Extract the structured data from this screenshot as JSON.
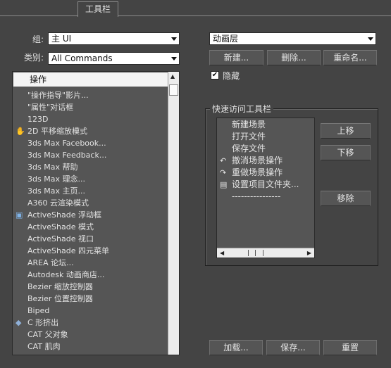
{
  "tab": {
    "label": "工具栏"
  },
  "group_field": {
    "label": "组:",
    "value": "主 UI"
  },
  "category_field": {
    "label": "类别:",
    "value": "All Commands"
  },
  "actions": {
    "header": "操作",
    "items": [
      {
        "icon": "",
        "label": "\"操作指导\"影片..."
      },
      {
        "icon": "",
        "label": "\"属性\"对话框"
      },
      {
        "icon": "",
        "label": "123D"
      },
      {
        "icon": "hand-pan-icon",
        "label": "2D 平移缩放模式"
      },
      {
        "icon": "",
        "label": "3ds Max Facebook..."
      },
      {
        "icon": "",
        "label": "3ds Max Feedback..."
      },
      {
        "icon": "",
        "label": "3ds Max 帮助"
      },
      {
        "icon": "",
        "label": "3ds Max 理念..."
      },
      {
        "icon": "",
        "label": "3ds Max 主页..."
      },
      {
        "icon": "",
        "label": "A360 云渲染模式"
      },
      {
        "icon": "activeshade-icon",
        "label": "ActiveShade 浮动框"
      },
      {
        "icon": "",
        "label": "ActiveShade 模式"
      },
      {
        "icon": "",
        "label": "ActiveShade 视口"
      },
      {
        "icon": "",
        "label": "ActiveShade 四元菜单"
      },
      {
        "icon": "",
        "label": "AREA 论坛..."
      },
      {
        "icon": "",
        "label": "Autodesk 动画商店..."
      },
      {
        "icon": "",
        "label": "Bezier 缩放控制器"
      },
      {
        "icon": "",
        "label": "Bezier 位置控制器"
      },
      {
        "icon": "",
        "label": "Biped"
      },
      {
        "icon": "c-extrude-icon",
        "label": "C 形挤出"
      },
      {
        "icon": "",
        "label": "CAT 父对象"
      },
      {
        "icon": "",
        "label": "CAT 肌肉"
      }
    ]
  },
  "toolbar_select": {
    "value": "动画层"
  },
  "buttons": {
    "new": "新建...",
    "delete": "删除...",
    "rename": "重命名...",
    "move_up": "上移",
    "move_down": "下移",
    "remove": "移除",
    "load": "加载...",
    "save": "保存...",
    "reset": "重置"
  },
  "hide_checkbox": {
    "label": "隐藏",
    "checked": true
  },
  "quick_access": {
    "title": "快速访问工具栏",
    "items": [
      {
        "icon": "",
        "label": "新建场景"
      },
      {
        "icon": "",
        "label": "打开文件"
      },
      {
        "icon": "",
        "label": "保存文件"
      },
      {
        "icon": "undo-arrow-icon",
        "label": "撤消场景操作"
      },
      {
        "icon": "redo-arrow-icon",
        "label": "重做场景操作"
      },
      {
        "icon": "project-folder-icon",
        "label": "设置项目文件夹..."
      },
      {
        "icon": "",
        "label": "----------------"
      }
    ]
  }
}
